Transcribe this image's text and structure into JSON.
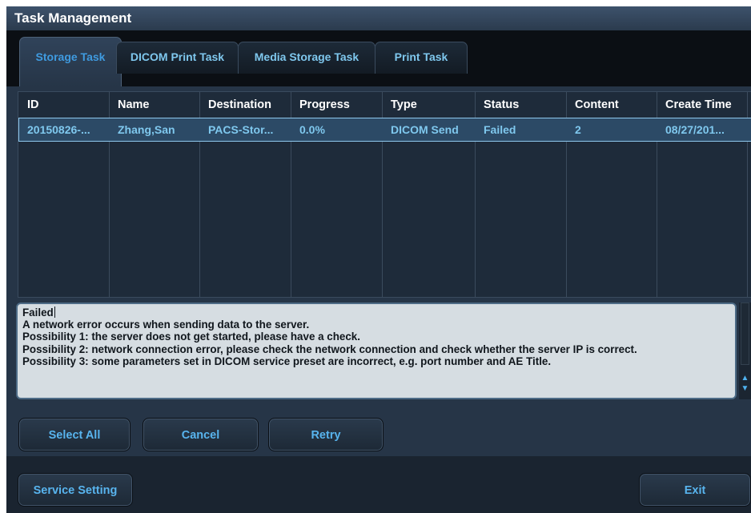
{
  "window": {
    "title": "Task Management"
  },
  "tabs": [
    {
      "label": "Storage Task",
      "active": true
    },
    {
      "label": "DICOM Print Task",
      "active": false
    },
    {
      "label": "Media Storage Task",
      "active": false
    },
    {
      "label": "Print Task",
      "active": false
    }
  ],
  "table": {
    "columns": [
      "ID",
      "Name",
      "Destination",
      "Progress",
      "Type",
      "Status",
      "Content",
      "Create Time"
    ],
    "rows": [
      {
        "id": "20150826-...",
        "name": "Zhang,San",
        "destination": "PACS-Stor...",
        "progress": "0.0%",
        "type": "DICOM Send",
        "status": "Failed",
        "content": "2",
        "create_time": "08/27/201..."
      }
    ]
  },
  "details": {
    "lines": [
      "Failed",
      "A network error occurs when sending data to the server.",
      "Possibility 1: the server does not get started, please have a check.",
      "Possibility 2: network connection error, please check the network connection and check whether the server IP is correct.",
      "Possibility 3: some parameters set in DICOM service preset are incorrect, e.g. port number and AE Title."
    ]
  },
  "buttons": {
    "select_all": "Select All",
    "cancel": "Cancel",
    "retry": "Retry",
    "service_setting": "Service Setting",
    "exit": "Exit"
  },
  "colors": {
    "accent": "#58b4ee",
    "active_tab_text": "#3f9be0",
    "selected_row": "#2c4a66",
    "panel": "#263547"
  },
  "icons": {
    "scroll_up": "scroll-up-arrow-icon",
    "scroll_down": "scroll-down-arrow-icon"
  }
}
